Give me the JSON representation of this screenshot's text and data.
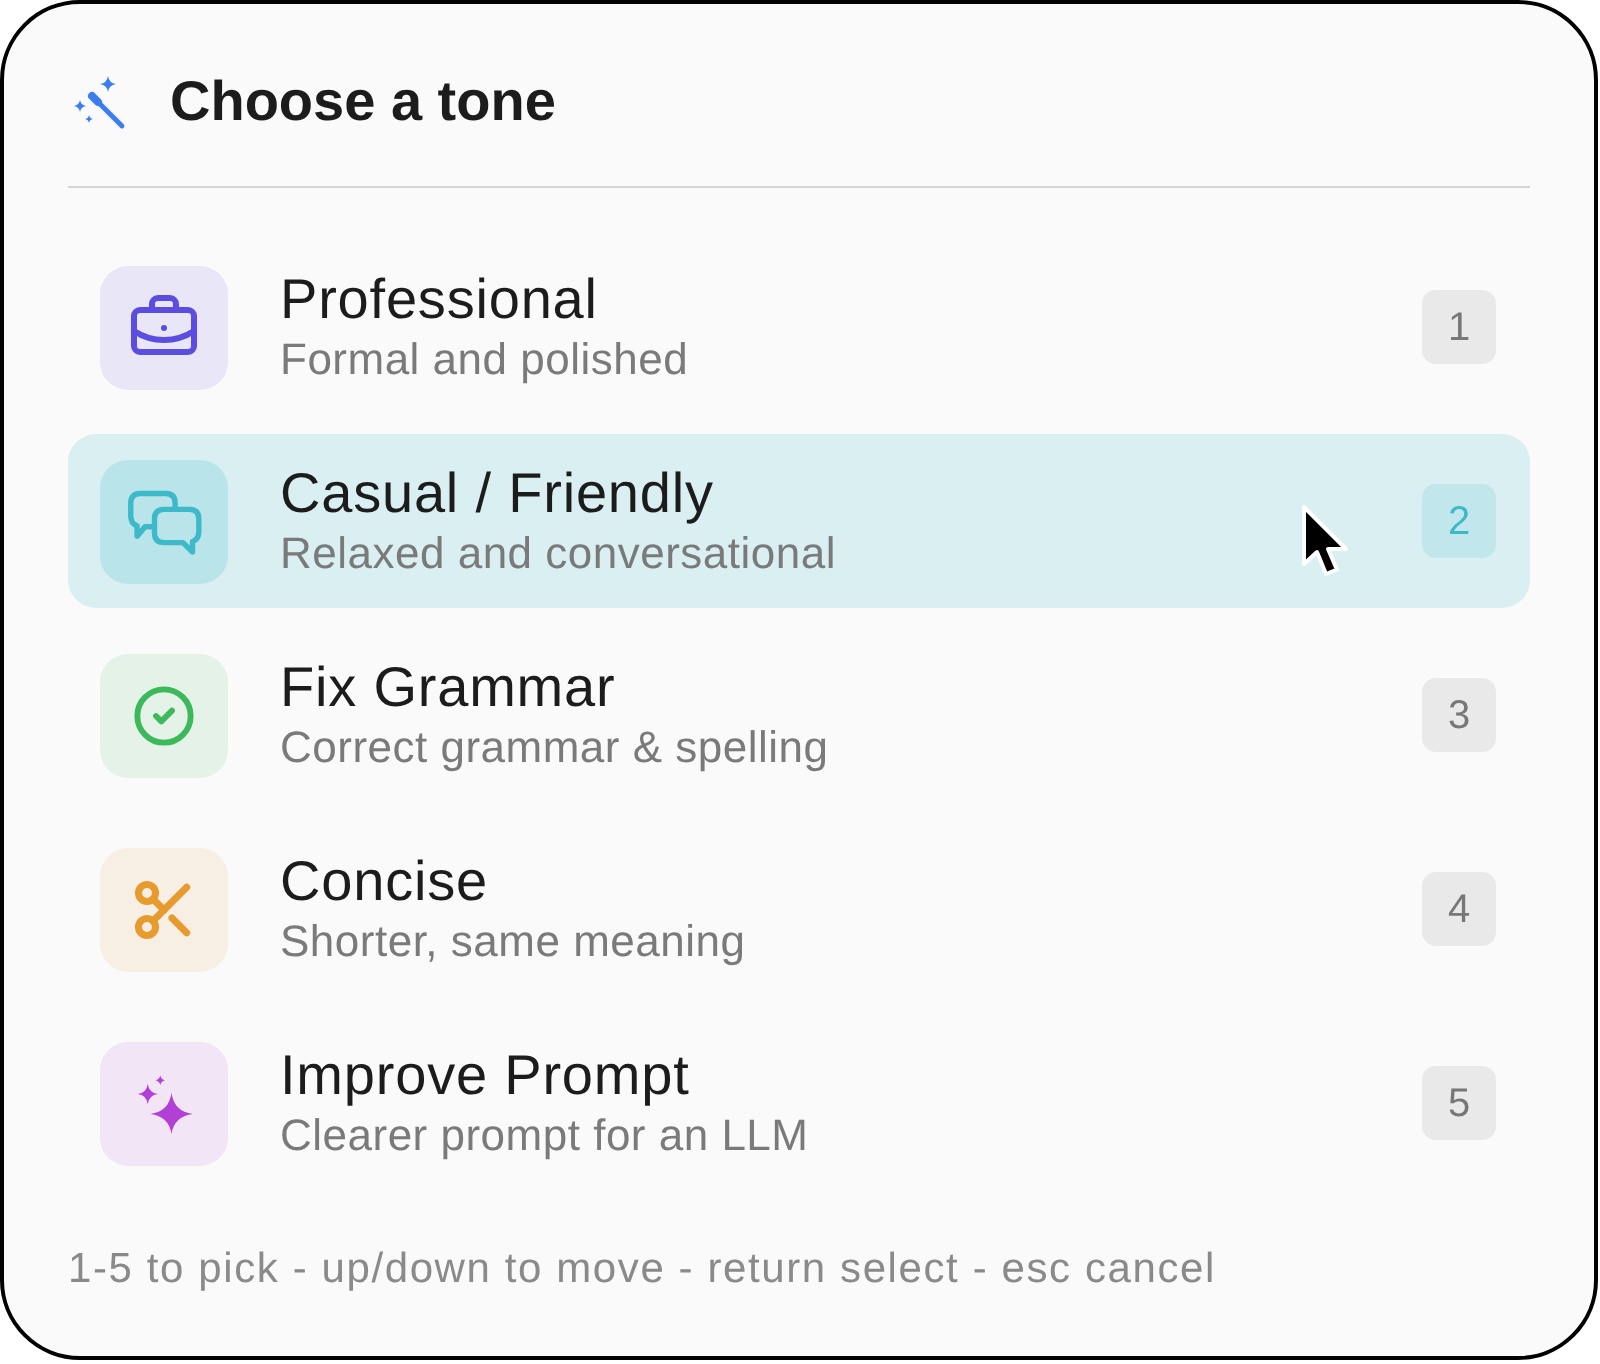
{
  "header": {
    "title": "Choose a tone"
  },
  "tones": [
    {
      "kind": "formal",
      "title": "Professional",
      "description": "Formal and polished",
      "shortcut": "1",
      "color": "#5b4de0",
      "selected": false
    },
    {
      "kind": "casual",
      "title": "Casual / Friendly",
      "description": "Relaxed and conversational",
      "shortcut": "2",
      "color": "#3db9c9",
      "selected": true
    },
    {
      "kind": "grammar",
      "title": "Fix Grammar",
      "description": "Correct grammar & spelling",
      "shortcut": "3",
      "color": "#3cb95a",
      "selected": false
    },
    {
      "kind": "concise",
      "title": "Concise",
      "description": "Shorter, same meaning",
      "shortcut": "4",
      "color": "#e79a2d",
      "selected": false
    },
    {
      "kind": "prompt",
      "title": "Improve Prompt",
      "description": "Clearer prompt for an LLM",
      "shortcut": "5",
      "color": "#b23fd6",
      "selected": false
    }
  ],
  "footer": {
    "hint": "1-5 to pick - up/down to move - return select - esc cancel"
  }
}
